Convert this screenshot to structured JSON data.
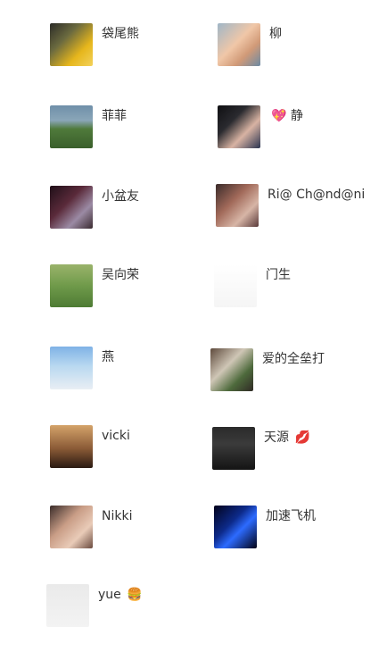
{
  "contacts": {
    "left": [
      {
        "name": "袋尾熊",
        "avatar": {
          "bg": "linear-gradient(135deg,#2c2c28 0%,#6b6a3f 35%,#e6b61c 70%,#f3d25c 100%)"
        }
      },
      {
        "name": "菲菲",
        "avatar": {
          "bg": "linear-gradient(#6f8fa9 0%,#8aa6b8 35%,#4f7a3b 55%,#3a5f2b 100%)"
        }
      },
      {
        "name": "小盆友",
        "avatar": {
          "bg": "linear-gradient(135deg,#1f0f18 0%,#5a2a3a 40%,#9b8aa4 70%,#3a2a2f 100%)"
        }
      },
      {
        "name": "吴向荣",
        "avatar": {
          "bg": "linear-gradient(#9ab36b 0%,#6f9a4a 50%,#4e7b34 100%)"
        }
      },
      {
        "name": "燕",
        "avatar": {
          "bg": "linear-gradient(#7fb2e6 0%,#b8d8f0 45%,#e9eef4 100%)"
        }
      },
      {
        "name": "vicki",
        "avatar": {
          "bg": "linear-gradient(#d4a36a 0%,#8a5a36 55%,#2a1a12 100%)"
        }
      },
      {
        "name": "Nikki",
        "avatar": {
          "bg": "linear-gradient(135deg,#3a2c2a 0%,#c99d86 40%,#e9cbb8 70%,#6a4a3e 100%)"
        }
      },
      {
        "name": "yue",
        "emoji": "🍔",
        "avatar": {
          "bg": "linear-gradient(#eaeaea 0%,#f3f3f3 100%)"
        }
      }
    ],
    "right": [
      {
        "name": "柳",
        "avatar": {
          "bg": "linear-gradient(135deg,#9fb6c7 0%,#f0c7a8 45%,#d19a78 70%,#6b8aa4 100%)"
        }
      },
      {
        "name": "静",
        "emoji": "💖",
        "avatar": {
          "bg": "linear-gradient(135deg,#0f0f12 0%,#2a2a2f 35%,#d8b3a3 65%,#2a3450 100%)"
        }
      },
      {
        "name": "Ri@ Ch@nd@ni",
        "avatar": {
          "bg": "linear-gradient(135deg,#3a2b2a 0%,#a26a5a 40%,#d7b5a6 70%,#5a3a3a 100%)"
        }
      },
      {
        "name": "门生",
        "avatar": {
          "bg": "linear-gradient(#ffffff 0%,#f5f5f5 100%)"
        }
      },
      {
        "name": "爱的全垒打",
        "avatar": {
          "bg": "linear-gradient(135deg,#5e4a3c 0%,#cfc6b6 40%,#4e6a3c 70%,#2f2a25 100%)"
        }
      },
      {
        "name": "天源",
        "emoji": "💋",
        "avatar": {
          "bg": "linear-gradient(#2a2a2a 0%,#3b3b3b 40%,#141414 100%)"
        }
      },
      {
        "name": "加速飞机",
        "avatar": {
          "bg": "linear-gradient(135deg,#02021a 0%,#0d2a8a 40%,#2d6bff 60%,#020214 100%)"
        }
      }
    ]
  }
}
